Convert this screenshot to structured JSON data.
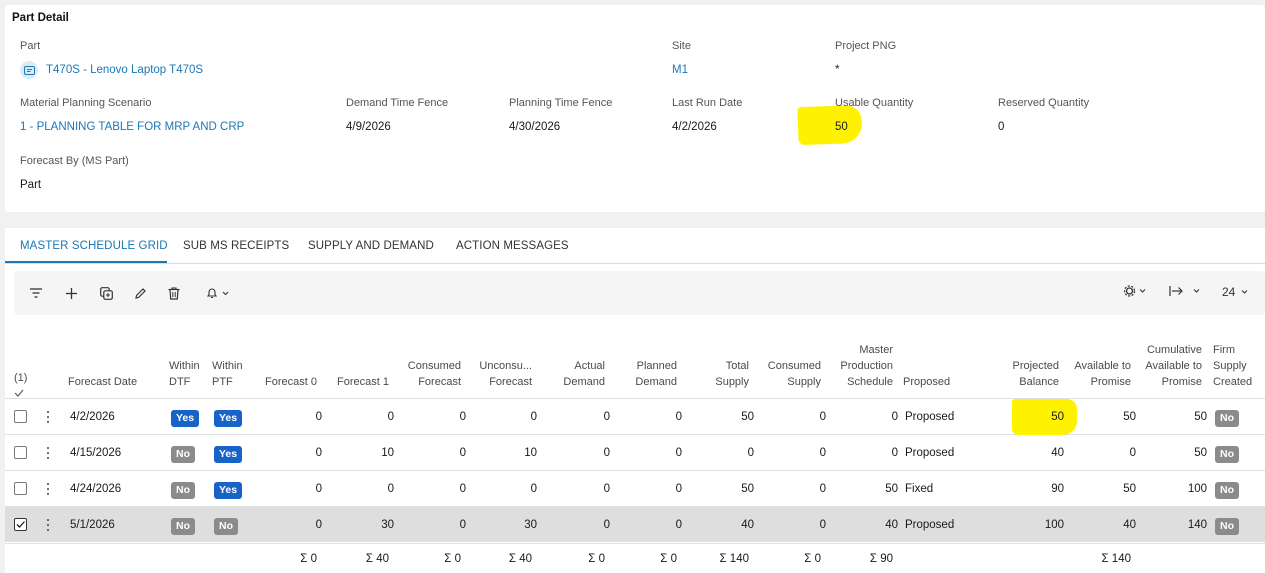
{
  "detail": {
    "title": "Part Detail",
    "part": {
      "label": "Part",
      "value": "T470S - Lenovo Laptop T470S"
    },
    "site": {
      "label": "Site",
      "value": "M1"
    },
    "project": {
      "label": "Project PNG",
      "value": "*"
    },
    "scenario": {
      "label": "Material Planning Scenario",
      "value": "1 - PLANNING TABLE FOR MRP AND CRP"
    },
    "dtf": {
      "label": "Demand Time Fence",
      "value": "4/9/2026"
    },
    "ptf": {
      "label": "Planning Time Fence",
      "value": "4/30/2026"
    },
    "last_run": {
      "label": "Last Run Date",
      "value": "4/2/2026"
    },
    "usable": {
      "label": "Usable Quantity",
      "value": "50"
    },
    "reserved": {
      "label": "Reserved Quantity",
      "value": "0"
    },
    "forecast_by": {
      "label": "Forecast By (MS Part)",
      "value": "Part"
    }
  },
  "tabs": [
    "MASTER SCHEDULE GRID",
    "SUB MS RECEIPTS",
    "SUPPLY AND DEMAND",
    "ACTION MESSAGES"
  ],
  "toolbar": {
    "page_size": "24"
  },
  "headers": {
    "selected": "(1)",
    "forecast_date": "Forecast Date",
    "within_dtf": [
      "Within",
      "DTF"
    ],
    "within_ptf": [
      "Within",
      "PTF"
    ],
    "forecast0": "Forecast 0",
    "forecast1": "Forecast 1",
    "consumed_forecast": [
      "Consumed",
      "Forecast"
    ],
    "unconsumed_forecast": [
      "Unconsu...",
      "Forecast"
    ],
    "actual_demand": [
      "Actual",
      "Demand"
    ],
    "planned_demand": [
      "Planned",
      "Demand"
    ],
    "total_supply": [
      "Total",
      "Supply"
    ],
    "consumed_supply": [
      "Consumed",
      "Supply"
    ],
    "mps": [
      "Master",
      "Production",
      "Schedule"
    ],
    "proposed": "Proposed",
    "projected_balance": [
      "Projected",
      "Balance"
    ],
    "atp": [
      "Available to",
      "Promise"
    ],
    "catp": [
      "Cumulative",
      "Available to",
      "Promise"
    ],
    "firm": [
      "Firm",
      "Supply",
      "Created"
    ]
  },
  "rows": [
    {
      "date": "4/2/2026",
      "dtf": "Yes",
      "ptf": "Yes",
      "f0": "0",
      "f1": "0",
      "cf": "0",
      "uf": "0",
      "ad": "0",
      "pd": "0",
      "ts": "50",
      "cs": "0",
      "mps": "0",
      "status": "Proposed",
      "pb": "50",
      "atp": "50",
      "catp": "50",
      "firm": "No"
    },
    {
      "date": "4/15/2026",
      "dtf": "No",
      "ptf": "Yes",
      "f0": "0",
      "f1": "10",
      "cf": "0",
      "uf": "10",
      "ad": "0",
      "pd": "0",
      "ts": "0",
      "cs": "0",
      "mps": "0",
      "status": "Proposed",
      "pb": "40",
      "atp": "0",
      "catp": "50",
      "firm": "No"
    },
    {
      "date": "4/24/2026",
      "dtf": "No",
      "ptf": "Yes",
      "f0": "0",
      "f1": "0",
      "cf": "0",
      "uf": "0",
      "ad": "0",
      "pd": "0",
      "ts": "50",
      "cs": "0",
      "mps": "50",
      "status": "Fixed",
      "pb": "90",
      "atp": "50",
      "catp": "100",
      "firm": "No"
    },
    {
      "date": "5/1/2026",
      "dtf": "No",
      "ptf": "No",
      "f0": "0",
      "f1": "30",
      "cf": "0",
      "uf": "30",
      "ad": "0",
      "pd": "0",
      "ts": "40",
      "cs": "0",
      "mps": "40",
      "status": "Proposed",
      "pb": "100",
      "atp": "40",
      "catp": "140",
      "firm": "No"
    }
  ],
  "totals": {
    "f0": "Σ 0",
    "f1": "Σ 40",
    "cf": "Σ 0",
    "uf": "Σ 40",
    "ad": "Σ 0",
    "pd": "Σ 0",
    "ts": "Σ 140",
    "cs": "Σ 0",
    "mps": "Σ 90",
    "atp": "Σ 140"
  },
  "colors": {
    "accent": "#1a78b4",
    "yes_badge": "#1763c7",
    "no_badge": "#8b8b8b",
    "highlight": "#fff200"
  }
}
